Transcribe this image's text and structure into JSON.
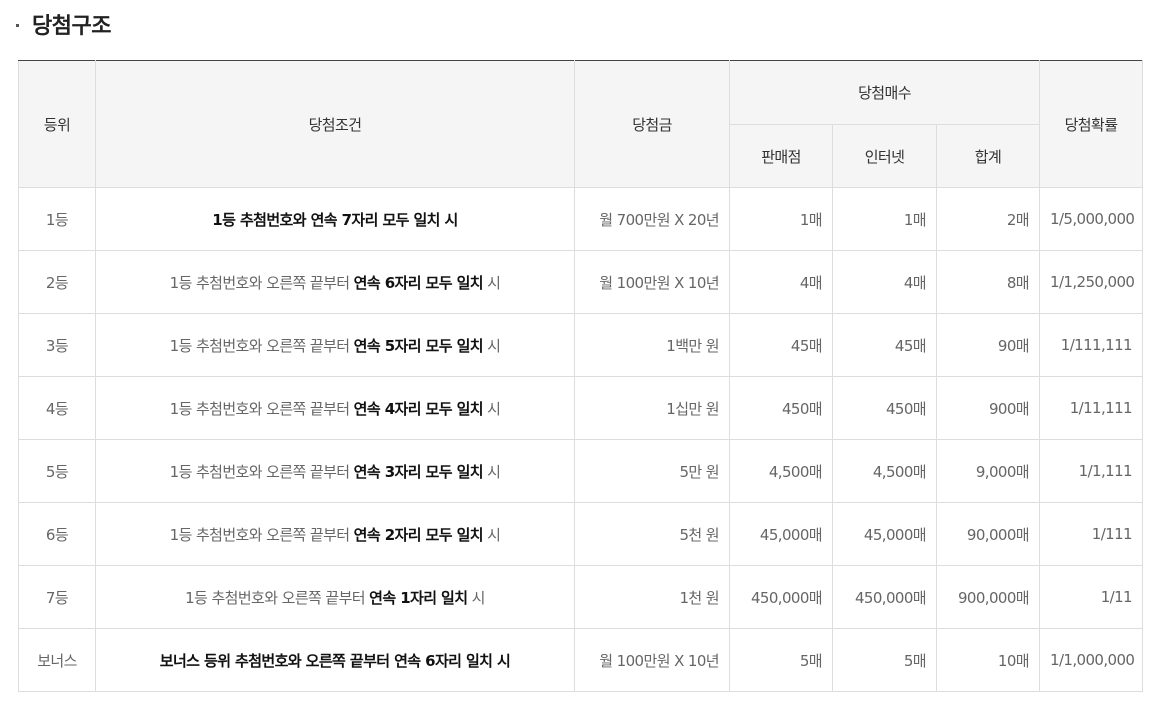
{
  "section": {
    "title": "당첨구조"
  },
  "table": {
    "headers": {
      "rank": "등위",
      "condition": "당첨조건",
      "prize": "당첨금",
      "count_group": "당첨매수",
      "store": "판매점",
      "internet": "인터넷",
      "total": "합계",
      "probability": "당첨확률"
    },
    "rows": [
      {
        "rank": "1등",
        "cond_prefix": "",
        "cond_bold": "1등 추첨번호와 연속 7자리 모두 일치 시",
        "cond_suffix": "",
        "prize": "월 700만원 X 20년",
        "store": "1매",
        "internet": "1매",
        "total": "2매",
        "probability": "1/5,000,000"
      },
      {
        "rank": "2등",
        "cond_prefix": "1등 추첨번호와 오른쪽 끝부터 ",
        "cond_bold": "연속 6자리 모두 일치",
        "cond_suffix": " 시",
        "prize": "월 100만원 X 10년",
        "store": "4매",
        "internet": "4매",
        "total": "8매",
        "probability": "1/1,250,000"
      },
      {
        "rank": "3등",
        "cond_prefix": "1등 추첨번호와 오른쪽 끝부터 ",
        "cond_bold": "연속 5자리 모두 일치",
        "cond_suffix": " 시",
        "prize": "1백만 원",
        "store": "45매",
        "internet": "45매",
        "total": "90매",
        "probability": "1/111,111"
      },
      {
        "rank": "4등",
        "cond_prefix": "1등 추첨번호와 오른쪽 끝부터 ",
        "cond_bold": "연속 4자리 모두 일치",
        "cond_suffix": " 시",
        "prize": "1십만 원",
        "store": "450매",
        "internet": "450매",
        "total": "900매",
        "probability": "1/11,111"
      },
      {
        "rank": "5등",
        "cond_prefix": "1등 추첨번호와 오른쪽 끝부터 ",
        "cond_bold": "연속 3자리 모두 일치",
        "cond_suffix": " 시",
        "prize": "5만 원",
        "store": "4,500매",
        "internet": "4,500매",
        "total": "9,000매",
        "probability": "1/1,111"
      },
      {
        "rank": "6등",
        "cond_prefix": "1등 추첨번호와 오른쪽 끝부터 ",
        "cond_bold": "연속 2자리 모두 일치",
        "cond_suffix": " 시",
        "prize": "5천 원",
        "store": "45,000매",
        "internet": "45,000매",
        "total": "90,000매",
        "probability": "1/111"
      },
      {
        "rank": "7등",
        "cond_prefix": "1등 추첨번호와 오른쪽 끝부터 ",
        "cond_bold": "연속 1자리 일치",
        "cond_suffix": " 시",
        "prize": "1천 원",
        "store": "450,000매",
        "internet": "450,000매",
        "total": "900,000매",
        "probability": "1/11"
      },
      {
        "rank": "보너스",
        "cond_prefix": "",
        "cond_bold": "보너스 등위 추첨번호와 오른쪽 끝부터 연속 6자리 일치 시",
        "cond_suffix": "",
        "prize": "월 100만원 X 10년",
        "store": "5매",
        "internet": "5매",
        "total": "10매",
        "probability": "1/1,000,000"
      }
    ]
  }
}
